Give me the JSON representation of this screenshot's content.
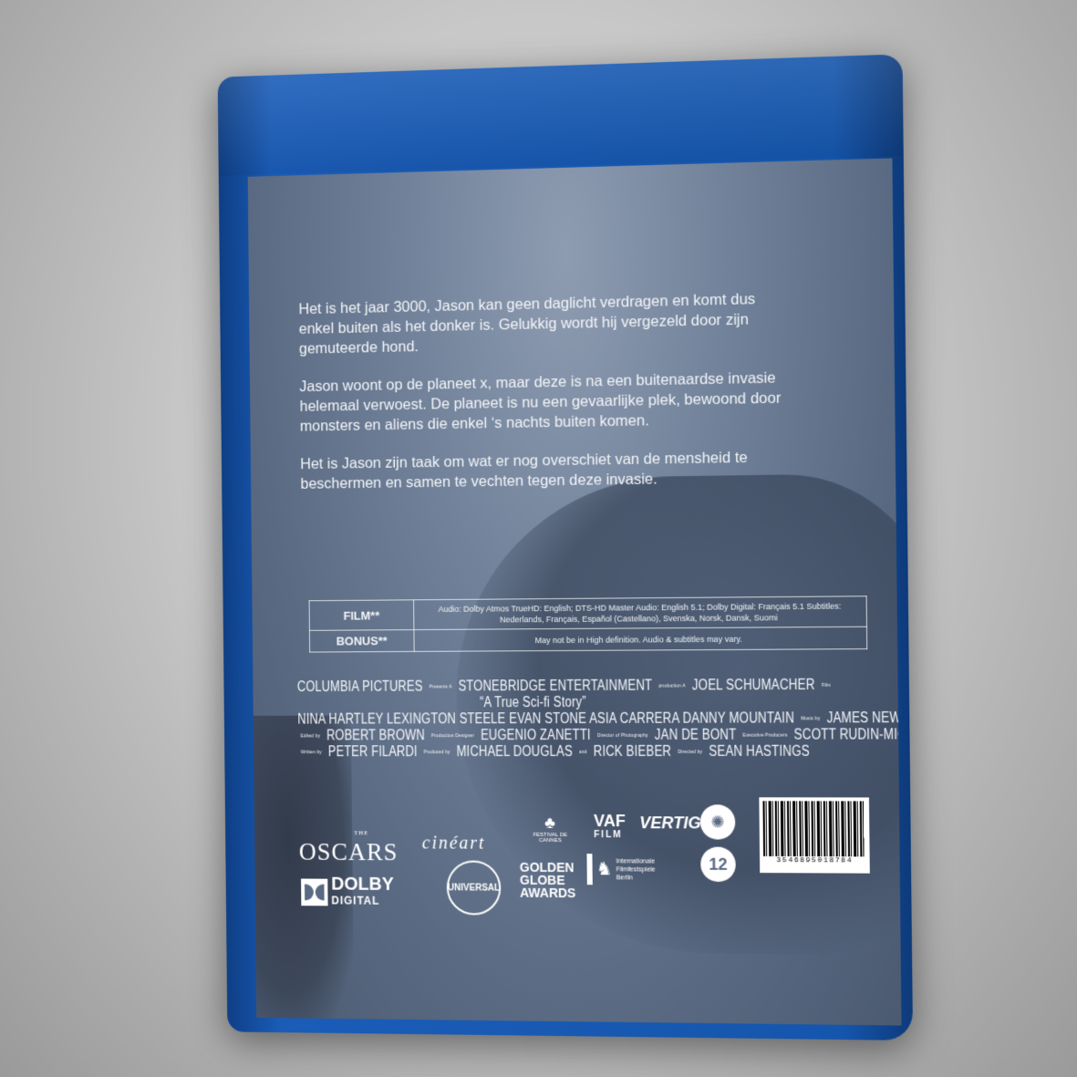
{
  "synopsis": {
    "p1": "Het is het jaar 3000, Jason kan geen daglicht verdragen en komt dus enkel buiten als het donker is. Gelukkig wordt hij vergezeld door zijn gemuteerde hond.",
    "p2": "Jason woont op de planeet x, maar deze is na een buitenaardse invasie helemaal verwoest. De planeet is nu een gevaarlijke plek, bewoond door monsters en aliens die enkel ‘s nachts buiten komen.",
    "p3": "Het is Jason zijn taak om wat er nog overschiet van de mensheid te beschermen en samen te vechten tegen deze invasie."
  },
  "specs": {
    "film_label": "FILM**",
    "film_value": "Audio: Dolby Atmos TrueHD: English; DTS-HD Master Audio: English 5.1; Dolby Digital: Français 5.1 Subtitles: Nederlands, Français, Español (Castellano), Svenska, Norsk, Dansk, Suomi",
    "bonus_label": "BONUS**",
    "bonus_value": "May not be in High definition. Audio & subtitles may vary."
  },
  "credits": {
    "studio": "COLUMBIA PICTURES",
    "presents": "Presents A",
    "company": "STONEBRIDGE ENTERTAINMENT",
    "production": "production A",
    "director_name": "JOEL SCHUMACHER",
    "film_word": "Film",
    "title": "“A True Sci-fi Story”",
    "cast": "NINA HARTLEY LEXINGTON STEELE EVAN STONE ASIA CARRERA DANNY MOUNTAIN",
    "music_by": "Music by",
    "composer": "JAMES NEWTON",
    "edited_by": "Edited by",
    "editor": "ROBERT BROWN",
    "production_designer_role": "Production Designer",
    "production_designer": "EUGENIO ZANETTI",
    "photography_role": "Director of Photography",
    "photographer": "JAN DE BONT",
    "exec_role": "Executive Producers",
    "exec_producers": "SCOTT RUDIN-MICHAEL RACHMIL",
    "written_by": "Written by",
    "writer": "PETER FILARDI",
    "produced_by": "Produced by",
    "producer": "MICHAEL DOUGLAS",
    "and": "and",
    "producer2": "RICK BIEBER",
    "directed_by": "Directed by",
    "director": "SEAN HASTINGS"
  },
  "logos": {
    "oscars_the": "THE",
    "oscars": "OSCARS",
    "cineart": "cinéart",
    "dolby": "DOLBY",
    "dolby_sub": "DIGITAL",
    "universal": "UNIVERSAL",
    "cannes": "FESTIVAL DE CANNES",
    "golden_globe": "GOLDEN GLOBE AWARDS",
    "berlin": "Internationale Filmfestspiele Berlin",
    "vaf": "VAF",
    "vaf_sub": "FILM",
    "vertigo": "VERTIGO",
    "age_rating": "12",
    "barcode_number": "3546895018784"
  }
}
